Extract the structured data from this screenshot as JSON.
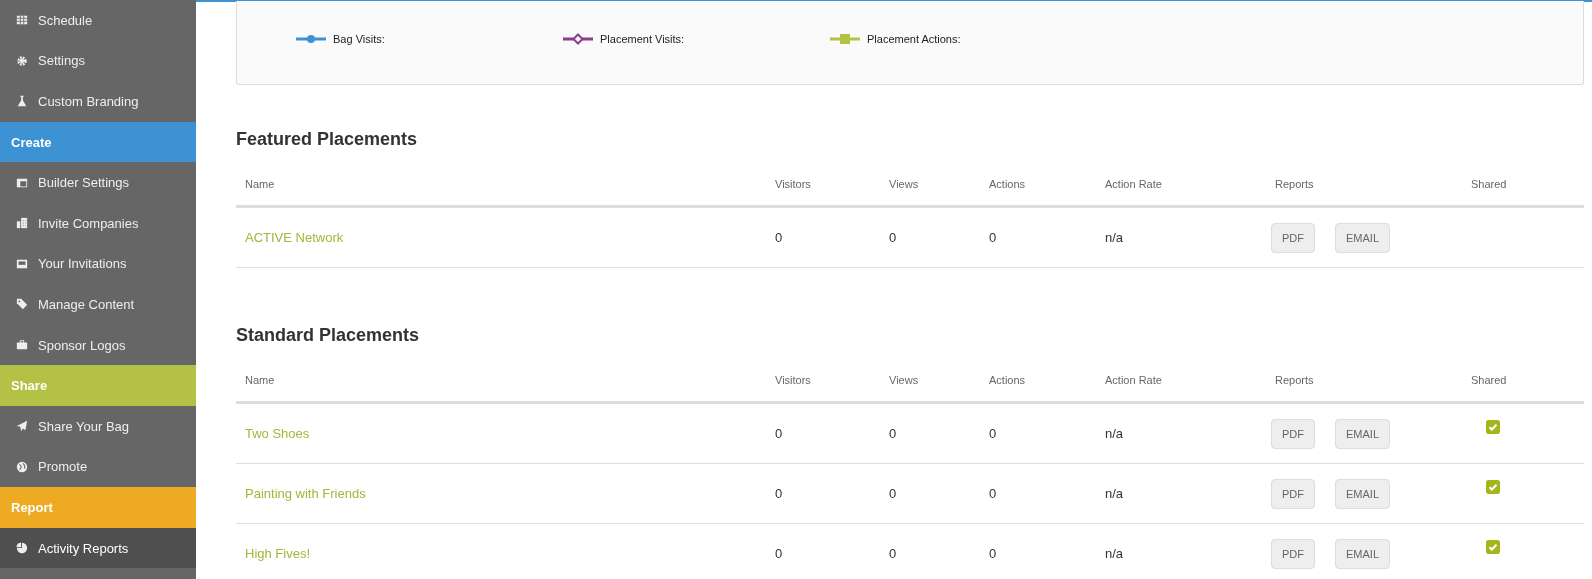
{
  "sidebar": {
    "top_items": [
      {
        "label": "Schedule",
        "selected": false
      },
      {
        "label": "Settings",
        "selected": false
      },
      {
        "label": "Custom Branding",
        "selected": false
      }
    ],
    "sections": [
      {
        "title": "Create",
        "color": "#3d92d4",
        "items": [
          {
            "label": "Builder Settings",
            "selected": false
          },
          {
            "label": "Invite Companies",
            "selected": false
          },
          {
            "label": "Your Invitations",
            "selected": false
          },
          {
            "label": "Manage Content",
            "selected": false
          },
          {
            "label": "Sponsor Logos",
            "selected": false
          }
        ]
      },
      {
        "title": "Share",
        "color": "#b3c144",
        "items": [
          {
            "label": "Share Your Bag",
            "selected": false
          },
          {
            "label": "Promote",
            "selected": false
          }
        ]
      },
      {
        "title": "Report",
        "color": "#eeaa22",
        "items": [
          {
            "label": "Activity Reports",
            "selected": true
          }
        ]
      }
    ]
  },
  "chart_legend": [
    {
      "label": "Bag Visits:",
      "color": "#3d92d4",
      "kind": "circle"
    },
    {
      "label": "Placement Visits:",
      "color": "#8e3a8e",
      "kind": "diamond"
    },
    {
      "label": "Placement Actions:",
      "color": "#b3c144",
      "kind": "square"
    }
  ],
  "tables": [
    {
      "title": "Featured Placements",
      "columns": [
        "Name",
        "Visitors",
        "Views",
        "Actions",
        "Action Rate",
        "Reports",
        "Shared"
      ],
      "rows": [
        {
          "name": "ACTIVE Network",
          "visitors": "0",
          "views": "0",
          "actions": "0",
          "action_rate": "n/a",
          "buttons": [
            "PDF",
            "EMAIL"
          ],
          "shared": false
        }
      ]
    },
    {
      "title": "Standard Placements",
      "columns": [
        "Name",
        "Visitors",
        "Views",
        "Actions",
        "Action Rate",
        "Reports",
        "Shared"
      ],
      "rows": [
        {
          "name": "Two Shoes",
          "visitors": "0",
          "views": "0",
          "actions": "0",
          "action_rate": "n/a",
          "buttons": [
            "PDF",
            "EMAIL"
          ],
          "shared": true
        },
        {
          "name": "Painting with Friends",
          "visitors": "0",
          "views": "0",
          "actions": "0",
          "action_rate": "n/a",
          "buttons": [
            "PDF",
            "EMAIL"
          ],
          "shared": true
        },
        {
          "name": "High Fives!",
          "visitors": "0",
          "views": "0",
          "actions": "0",
          "action_rate": "n/a",
          "buttons": [
            "PDF",
            "EMAIL"
          ],
          "shared": true
        }
      ]
    }
  ]
}
